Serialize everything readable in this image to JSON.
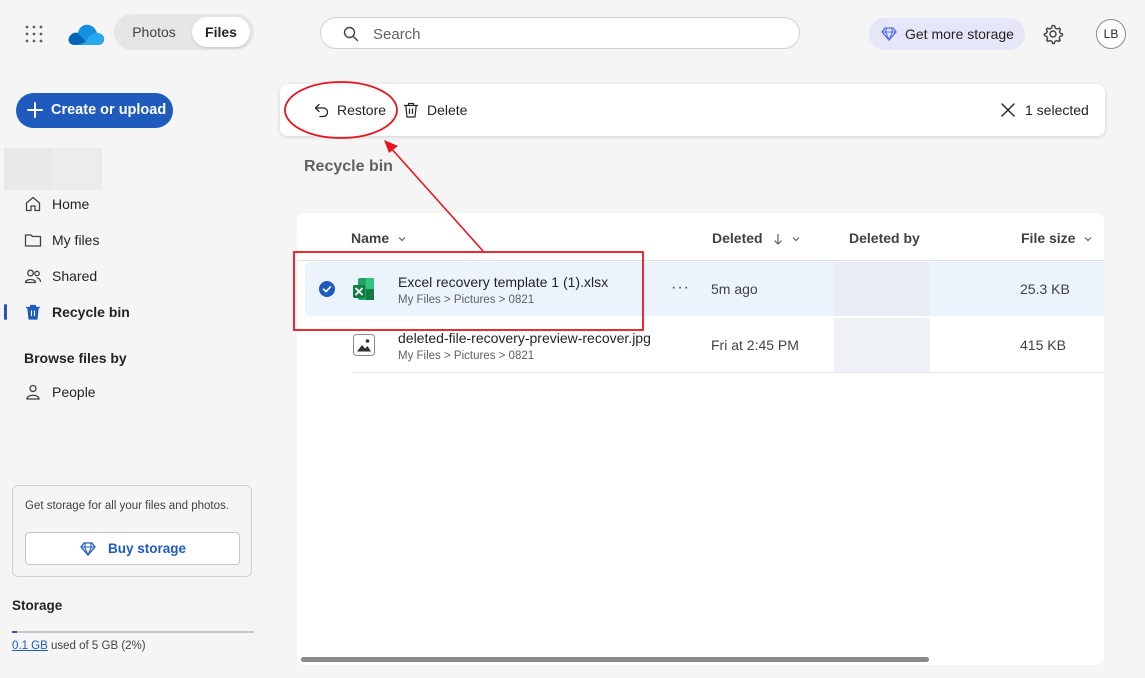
{
  "topbar": {
    "app_name": "OneDrive",
    "tabs": [
      {
        "label": "Photos",
        "selected": false
      },
      {
        "label": "Files",
        "selected": true
      }
    ],
    "search": {
      "placeholder": "Search",
      "value": ""
    },
    "get_storage_label": "Get more storage",
    "avatar_initials": "LB",
    "icons": [
      "app-launcher-icon",
      "onedrive-logo-icon",
      "search-icon",
      "diamond-icon",
      "gear-icon"
    ]
  },
  "sidebar": {
    "create_label": "Create or upload",
    "nav": [
      {
        "label": "Home",
        "icon": "home-icon"
      },
      {
        "label": "My files",
        "icon": "folder-icon"
      },
      {
        "label": "Shared",
        "icon": "people-icon"
      },
      {
        "label": "Recycle bin",
        "icon": "trash-icon",
        "active": true
      }
    ],
    "browse_heading": "Browse files by",
    "browse": [
      {
        "label": "People",
        "icon": "person-icon"
      }
    ],
    "promo_text": "Get storage for all your files and photos.",
    "buy_label": "Buy storage",
    "storage_heading": "Storage",
    "storage_used": "0.1 GB",
    "storage_rest": " used of 5 GB (2%)",
    "storage_fraction": 0.02
  },
  "commandbar": {
    "restore_label": "Restore",
    "delete_label": "Delete",
    "selected_label": "1 selected"
  },
  "page_title": "Recycle bin",
  "list": {
    "columns": {
      "name": "Name",
      "deleted": "Deleted",
      "deleted_by": "Deleted by",
      "file_size": "File size"
    },
    "rows": [
      {
        "name": "Excel recovery template 1 (1).xlsx",
        "path": "My Files > Pictures > 0821",
        "deleted": "5m ago",
        "file_size": "25.3 KB",
        "selected": true,
        "icon": "excel-file-icon",
        "more": "···"
      },
      {
        "name": "deleted-file-recovery-preview-recover.jpg",
        "path": "My Files > Pictures > 0821",
        "deleted": "Fri at 2:45 PM",
        "file_size": "415 KB",
        "selected": false,
        "icon": "image-file-icon"
      }
    ]
  },
  "annotation": {
    "color": "#e8141e"
  },
  "colors": {
    "accent": "#1f5bbd",
    "selected_row": "#ebf3fc"
  }
}
